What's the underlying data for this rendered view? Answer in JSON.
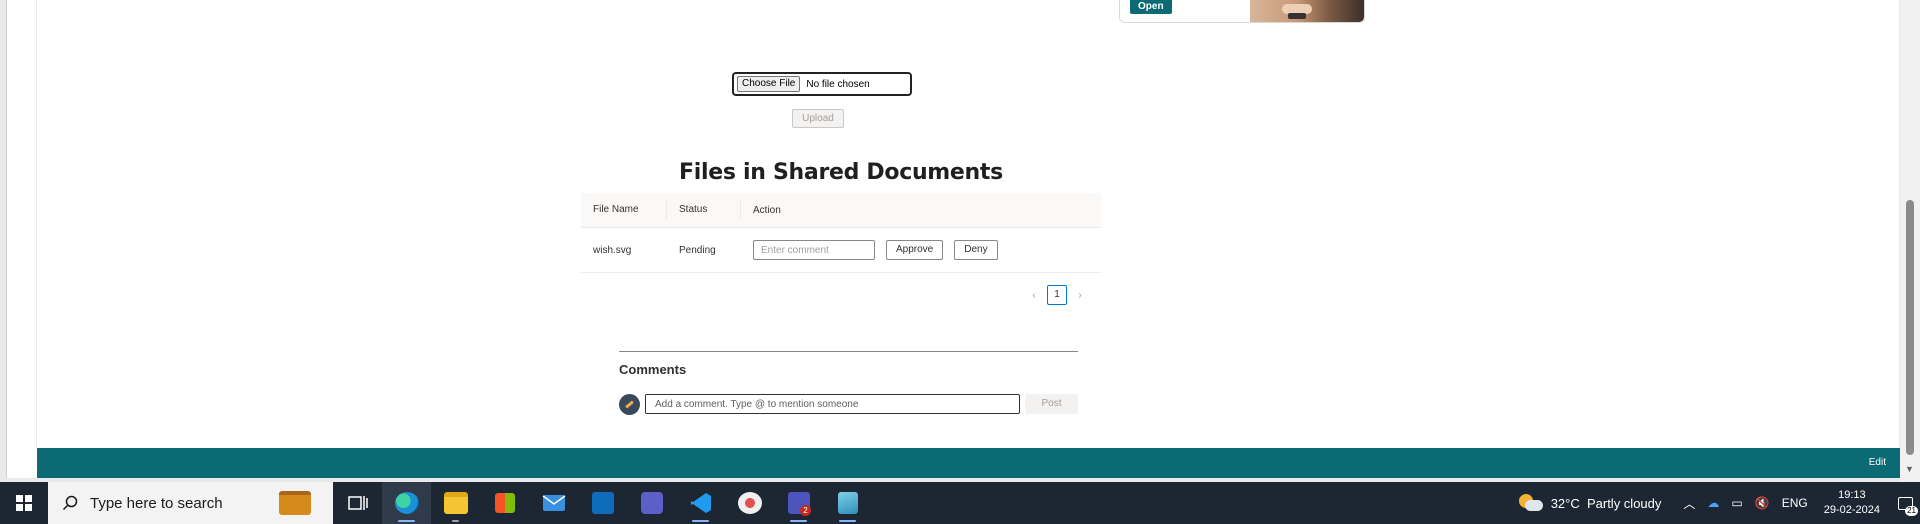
{
  "ad": {
    "open_label": "Open"
  },
  "upload": {
    "choose_file_label": "Choose File",
    "no_file_text": "No file chosen",
    "upload_label": "Upload"
  },
  "files_section": {
    "title": "Files in Shared Documents",
    "columns": [
      "File Name",
      "Status",
      "Action"
    ],
    "rows": [
      {
        "file_name": "wish.svg",
        "status": "Pending",
        "comment_placeholder": "Enter comment",
        "approve_label": "Approve",
        "deny_label": "Deny"
      }
    ],
    "pagination": {
      "prev_icon": "‹",
      "current_page": "1",
      "next_icon": "›"
    }
  },
  "comments": {
    "title": "Comments",
    "input_placeholder": "Add a comment. Type @ to mention someone",
    "post_label": "Post"
  },
  "footer": {
    "edit_label": "Edit"
  },
  "colors": {
    "footer_teal": "#0b6a73",
    "ad_open": "#0b6a73",
    "taskbar": "#1c2733"
  },
  "taskbar": {
    "search_placeholder": "Type here to search",
    "apps": [
      "task-view",
      "edge",
      "file-explorer",
      "microsoft-store",
      "mail",
      "outlook",
      "teams",
      "vs-code",
      "snipping-tool",
      "teams-classic",
      "notepad"
    ],
    "teams_badge": "2",
    "weather": {
      "temp": "32°C",
      "condition": "Partly cloudy"
    },
    "language": "ENG",
    "time": "19:13",
    "date": "29-02-2024",
    "notification_count": "21"
  }
}
